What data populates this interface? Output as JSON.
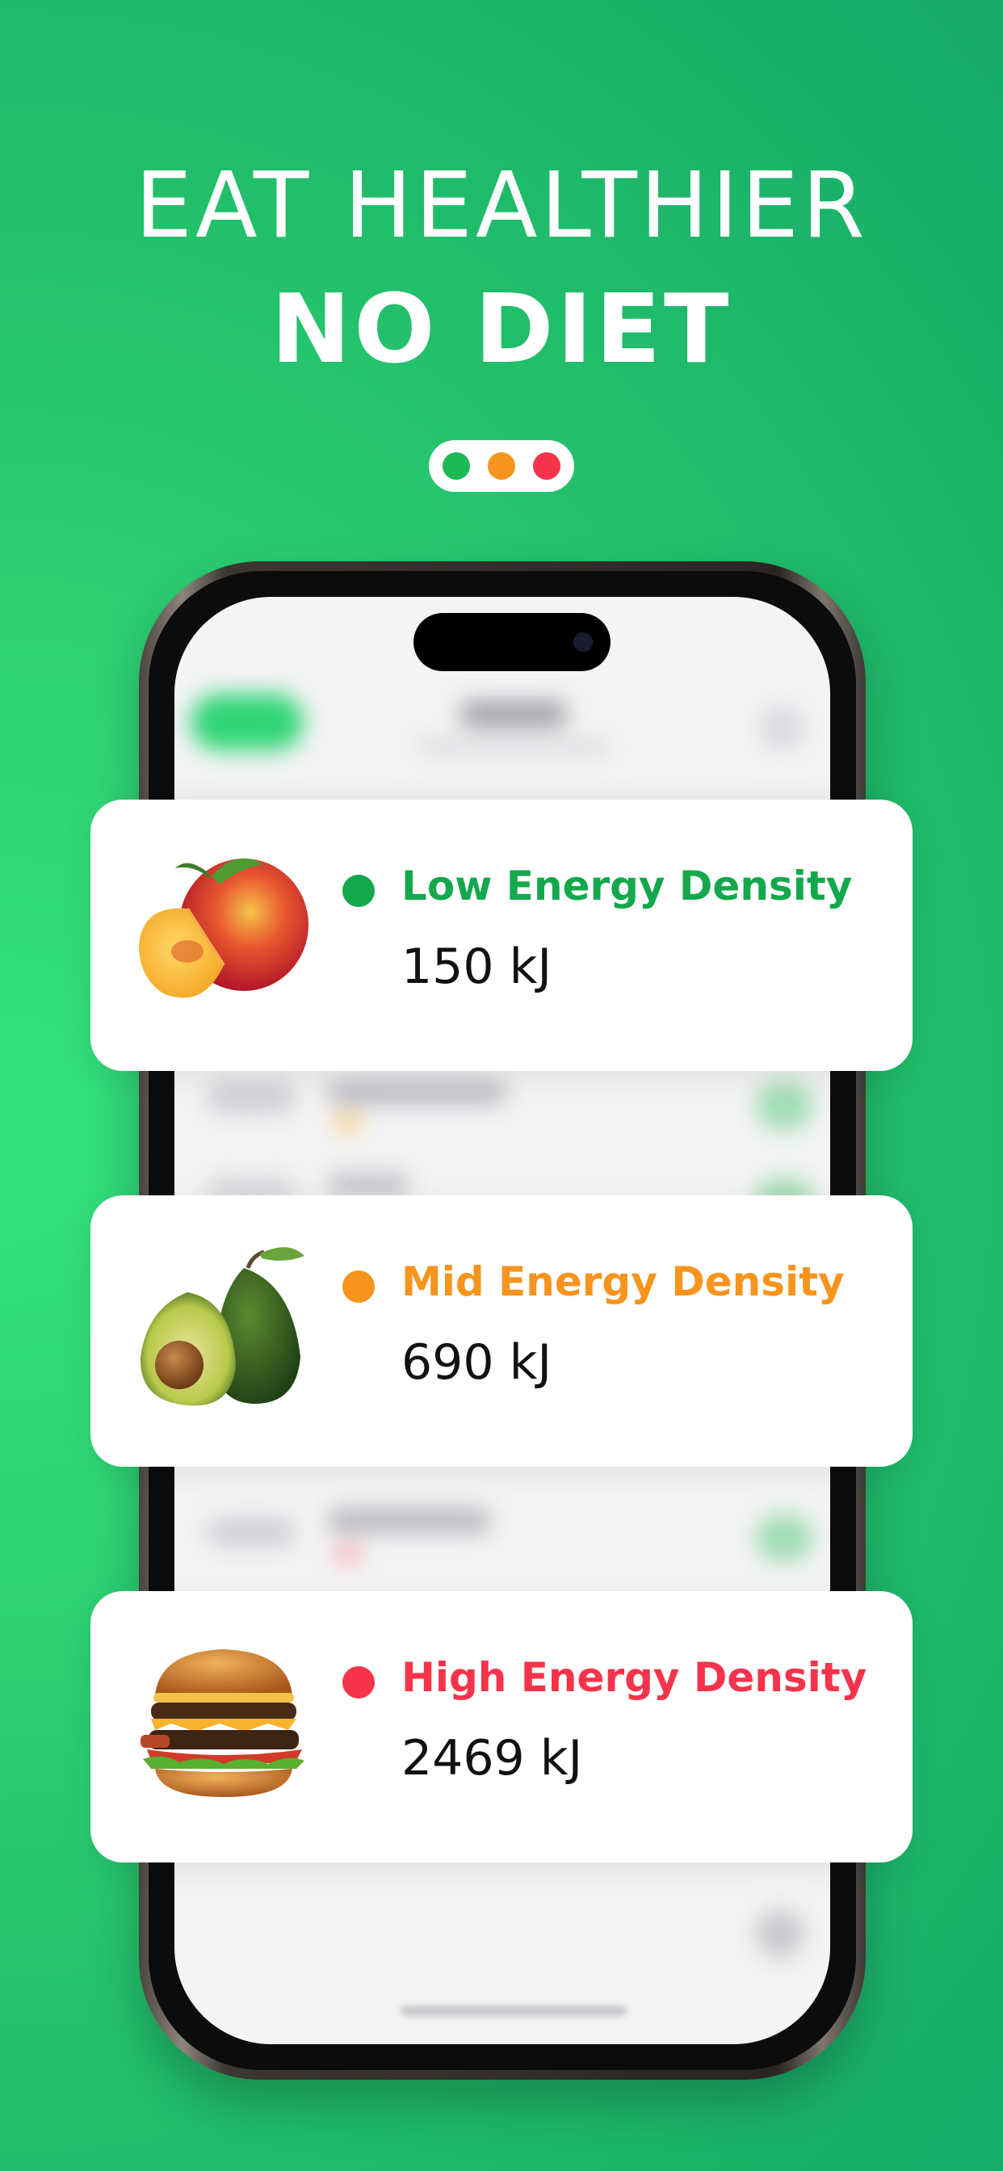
{
  "headline": {
    "line1": "EAT HEALTHIER",
    "line2": "NO DIET"
  },
  "indicator": {
    "dots": [
      {
        "color": "#1db954",
        "name": "green"
      },
      {
        "color": "#f7941d",
        "name": "orange"
      },
      {
        "color": "#f5334a",
        "name": "red"
      }
    ]
  },
  "cards": [
    {
      "food_icon": "peach-icon",
      "label": "Low Energy Density",
      "value": "150 kJ",
      "color": "#14a84c"
    },
    {
      "food_icon": "avocado-icon",
      "label": "Mid Energy Density",
      "value": "690 kJ",
      "color": "#f7941d"
    },
    {
      "food_icon": "burger-icon",
      "label": "High Energy Density",
      "value": "2469 kJ",
      "color": "#f5334a"
    }
  ]
}
